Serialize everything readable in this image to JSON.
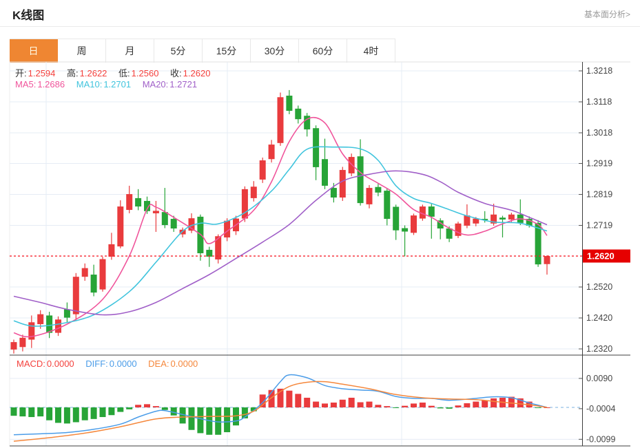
{
  "header": {
    "title": "K线图",
    "link": "基本面分析>"
  },
  "tabs": {
    "items": [
      "日",
      "周",
      "月",
      "5分",
      "15分",
      "30分",
      "60分",
      "4时"
    ],
    "active_index": 0
  },
  "info": {
    "open_label": "开:",
    "open": "1.2594",
    "high_label": "高:",
    "high": "1.2622",
    "low_label": "低:",
    "low": "1.2560",
    "close_label": "收:",
    "close": "1.2620",
    "ma5_label": "MA5:",
    "ma5": "1.2686",
    "ma10_label": "MA10:",
    "ma10": "1.2701",
    "ma20_label": "MA20:",
    "ma20": "1.2721"
  },
  "macd_info": {
    "macd_label": "MACD:",
    "macd": "0.0000",
    "diff_label": "DIFF:",
    "diff": "0.0000",
    "dea_label": "DEA:",
    "dea": "0.0000"
  },
  "colors": {
    "up": "#e93b3d",
    "down": "#27a437",
    "ma5": "#f0549b",
    "ma10": "#40c4dd",
    "ma20": "#a05fc8",
    "diff": "#4a9ce8",
    "dea": "#f5873b",
    "accent": "#ef8632",
    "marker_bg": "#e60000",
    "marker_text": "#ffffff",
    "grid": "#e6ecf5",
    "axis_text": "#444444",
    "axis_line": "#3c3c3c",
    "dotted": "#f5222d",
    "zero_dash": "#bcd8f0"
  },
  "chart_data": {
    "type": "candlestick",
    "title": "K线图 daily candlestick with MA5/MA10/MA20 and MACD",
    "price_ticks": [
      "1.3218",
      "1.3118",
      "1.3018",
      "1.2919",
      "1.2819",
      "1.2719",
      "1.2520",
      "1.2420",
      "1.2320"
    ],
    "current_price": {
      "label": "1.2620",
      "value": 1.262
    },
    "candles": [
      [
        1.2318,
        1.235,
        1.2305,
        1.2342
      ],
      [
        1.2326,
        1.2366,
        1.2312,
        1.2356
      ],
      [
        1.235,
        1.2428,
        1.2323,
        1.2406
      ],
      [
        1.24,
        1.2445,
        1.2385,
        1.2432
      ],
      [
        1.2428,
        1.244,
        1.2355,
        1.2372
      ],
      [
        1.2372,
        1.2425,
        1.2362,
        1.2415
      ],
      [
        1.2448,
        1.247,
        1.2405,
        1.2421
      ],
      [
        1.2432,
        1.2565,
        1.2413,
        1.2553
      ],
      [
        1.2553,
        1.2596,
        1.254,
        1.2581
      ],
      [
        1.256,
        1.2592,
        1.249,
        1.2502
      ],
      [
        1.2512,
        1.2618,
        1.2505,
        1.261
      ],
      [
        1.2618,
        1.2695,
        1.2608,
        1.2658
      ],
      [
        1.2651,
        1.28,
        1.2645,
        1.278
      ],
      [
        1.2769,
        1.2847,
        1.2758,
        1.282
      ],
      [
        1.2807,
        1.2836,
        1.2768,
        1.278
      ],
      [
        1.2798,
        1.2812,
        1.2756,
        1.2765
      ],
      [
        1.2758,
        1.2798,
        1.2698,
        1.2766
      ],
      [
        1.2762,
        1.284,
        1.271,
        1.272
      ],
      [
        1.274,
        1.275,
        1.2698,
        1.2709
      ],
      [
        1.269,
        1.2712,
        1.268,
        1.2705
      ],
      [
        1.2702,
        1.2758,
        1.2694,
        1.2742
      ],
      [
        1.2747,
        1.2754,
        1.2605,
        1.2629
      ],
      [
        1.264,
        1.265,
        1.2585,
        1.2618
      ],
      [
        1.2609,
        1.269,
        1.2596,
        1.2684
      ],
      [
        1.268,
        1.2742,
        1.2668,
        1.2734
      ],
      [
        1.27,
        1.275,
        1.2688,
        1.2741
      ],
      [
        1.2741,
        1.2845,
        1.273,
        1.2836
      ],
      [
        1.2807,
        1.2862,
        1.2796,
        1.2844
      ],
      [
        1.2867,
        1.2938,
        1.2856,
        1.2929
      ],
      [
        1.2933,
        1.2995,
        1.2922,
        1.298
      ],
      [
        1.2985,
        1.3148,
        1.2976,
        1.3133
      ],
      [
        1.3138,
        1.3156,
        1.3078,
        1.3089
      ],
      [
        1.3096,
        1.3106,
        1.3048,
        1.3062
      ],
      [
        1.3073,
        1.3082,
        1.3006,
        1.3029
      ],
      [
        1.3033,
        1.3042,
        1.2865,
        1.2907
      ],
      [
        1.2933,
        1.2999,
        1.2836,
        1.2847
      ],
      [
        1.284,
        1.2856,
        1.2793,
        1.2809
      ],
      [
        1.2809,
        1.2908,
        1.2798,
        1.2898
      ],
      [
        1.2887,
        1.2951,
        1.2878,
        1.294
      ],
      [
        1.2942,
        1.2997,
        1.2783,
        1.2791
      ],
      [
        1.2787,
        1.2849,
        1.2774,
        1.284
      ],
      [
        1.2843,
        1.2853,
        1.2813,
        1.2825
      ],
      [
        1.2831,
        1.2839,
        1.2719,
        1.274
      ],
      [
        1.2779,
        1.2786,
        1.2672,
        1.2703
      ],
      [
        1.271,
        1.2719,
        1.2619,
        1.2699
      ],
      [
        1.2695,
        1.2757,
        1.2688,
        1.2751
      ],
      [
        1.2741,
        1.2786,
        1.2734,
        1.278
      ],
      [
        1.278,
        1.2788,
        1.2676,
        1.2747
      ],
      [
        1.2735,
        1.2742,
        1.2674,
        1.2709
      ],
      [
        1.2709,
        1.2716,
        1.2665,
        1.2676
      ],
      [
        1.2685,
        1.2731,
        1.2678,
        1.2725
      ],
      [
        1.2718,
        1.2787,
        1.271,
        1.2751
      ],
      [
        1.2725,
        1.2746,
        1.2716,
        1.2741
      ],
      [
        1.274,
        1.2765,
        1.2728,
        1.2736
      ],
      [
        1.2725,
        1.2789,
        1.2718,
        1.2754
      ],
      [
        1.2744,
        1.275,
        1.268,
        1.2738
      ],
      [
        1.2738,
        1.276,
        1.273,
        1.2754
      ],
      [
        1.2754,
        1.2803,
        1.272,
        1.2727
      ],
      [
        1.274,
        1.2748,
        1.2712,
        1.2718
      ],
      [
        1.2727,
        1.2736,
        1.2585,
        1.2593
      ],
      [
        1.2594,
        1.2622,
        1.256,
        1.262
      ]
    ],
    "ma_lines": [
      {
        "name": "MA5",
        "color_key": "ma5",
        "points": [
          [
            0,
            1.2372
          ],
          [
            2,
            1.236
          ],
          [
            6,
            1.24
          ],
          [
            10,
            1.248
          ],
          [
            13,
            1.262
          ],
          [
            15,
            1.2772
          ],
          [
            16,
            1.2778
          ],
          [
            18,
            1.2745
          ],
          [
            21,
            1.269
          ],
          [
            22,
            1.266
          ],
          [
            24,
            1.27
          ],
          [
            27,
            1.2768
          ],
          [
            29,
            1.286
          ],
          [
            31,
            1.299
          ],
          [
            33,
            1.3062
          ],
          [
            35,
            1.305
          ],
          [
            37,
            1.295
          ],
          [
            39,
            1.289
          ],
          [
            41,
            1.2855
          ],
          [
            43,
            1.282
          ],
          [
            45,
            1.277
          ],
          [
            47,
            1.2745
          ],
          [
            49,
            1.271
          ],
          [
            51,
            1.2688
          ],
          [
            53,
            1.27
          ],
          [
            55,
            1.2724
          ],
          [
            57,
            1.274
          ],
          [
            59,
            1.2722
          ],
          [
            60,
            1.2686
          ]
        ]
      },
      {
        "name": "MA10",
        "color_key": "ma10",
        "points": [
          [
            0,
            1.2411
          ],
          [
            2,
            1.2394
          ],
          [
            5,
            1.24
          ],
          [
            9,
            1.243
          ],
          [
            13,
            1.2505
          ],
          [
            16,
            1.26
          ],
          [
            19,
            1.27
          ],
          [
            21,
            1.2726
          ],
          [
            23,
            1.2724
          ],
          [
            26,
            1.276
          ],
          [
            29,
            1.283
          ],
          [
            31,
            1.29
          ],
          [
            33,
            1.2965
          ],
          [
            36,
            1.2972
          ],
          [
            39,
            1.2966
          ],
          [
            41,
            1.2929
          ],
          [
            43,
            1.2847
          ],
          [
            45,
            1.2806
          ],
          [
            47,
            1.279
          ],
          [
            49,
            1.277
          ],
          [
            51,
            1.275
          ],
          [
            54,
            1.273
          ],
          [
            57,
            1.2726
          ],
          [
            60,
            1.2701
          ]
        ]
      },
      {
        "name": "MA20",
        "color_key": "ma20",
        "points": [
          [
            0,
            1.249
          ],
          [
            3,
            1.247
          ],
          [
            6,
            1.2448
          ],
          [
            10,
            1.243
          ],
          [
            13,
            1.244
          ],
          [
            16,
            1.247
          ],
          [
            19,
            1.2515
          ],
          [
            22,
            1.256
          ],
          [
            25,
            1.2612
          ],
          [
            28,
            1.2665
          ],
          [
            31,
            1.2722
          ],
          [
            34,
            1.28
          ],
          [
            37,
            1.2862
          ],
          [
            40,
            1.2884
          ],
          [
            43,
            1.2895
          ],
          [
            46,
            1.2884
          ],
          [
            48,
            1.286
          ],
          [
            50,
            1.2826
          ],
          [
            53,
            1.279
          ],
          [
            56,
            1.2768
          ],
          [
            58,
            1.2745
          ],
          [
            60,
            1.2721
          ]
        ]
      }
    ],
    "macd": {
      "ticks": [
        "0.0090",
        "-0.0004",
        "-0.0099"
      ],
      "bars": [
        -0.0026,
        -0.0028,
        -0.003,
        -0.0028,
        -0.004,
        -0.0048,
        -0.005,
        -0.0046,
        -0.004,
        -0.0036,
        -0.003,
        -0.0024,
        -0.0014,
        -0.0006,
        0.0008,
        0.001,
        0.0004,
        -0.0008,
        -0.0025,
        -0.005,
        -0.007,
        -0.008,
        -0.0085,
        -0.0085,
        -0.0077,
        -0.0056,
        -0.0034,
        -0.0012,
        0.004,
        0.0054,
        0.0058,
        0.0052,
        0.0042,
        0.003,
        0.0018,
        0.0012,
        0.0015,
        0.0024,
        0.003,
        0.0016,
        0.0018,
        0.0008,
        0.0004,
        -0.0002,
        0.0005,
        0.0012,
        0.0015,
        0.0005,
        -0.0003,
        -0.0004,
        0.0006,
        0.0013,
        0.0018,
        0.0022,
        0.0028,
        0.003,
        0.0033,
        0.0028,
        0.0018,
        -0.0002,
        0.0
      ],
      "lines": [
        {
          "name": "DIFF",
          "color_key": "diff",
          "points": [
            [
              0,
              -0.0085
            ],
            [
              3,
              -0.0082
            ],
            [
              6,
              -0.0078
            ],
            [
              9,
              -0.0068
            ],
            [
              12,
              -0.0052
            ],
            [
              14,
              -0.003
            ],
            [
              16,
              -0.0012
            ],
            [
              17,
              -0.001
            ],
            [
              19,
              -0.0022
            ],
            [
              21,
              -0.0035
            ],
            [
              23,
              -0.0045
            ],
            [
              25,
              -0.0042
            ],
            [
              26,
              -0.003
            ],
            [
              28,
              0.0015
            ],
            [
              30,
              0.008
            ],
            [
              31,
              0.0101
            ],
            [
              33,
              0.0092
            ],
            [
              35,
              0.0068
            ],
            [
              37,
              0.0058
            ],
            [
              39,
              0.0054
            ],
            [
              41,
              0.005
            ],
            [
              43,
              0.0034
            ],
            [
              45,
              0.0028
            ],
            [
              47,
              0.0028
            ],
            [
              49,
              0.0022
            ],
            [
              52,
              0.0028
            ],
            [
              54,
              0.0033
            ],
            [
              56,
              0.003
            ],
            [
              58,
              0.0014
            ],
            [
              60,
              0.0
            ]
          ]
        },
        {
          "name": "DEA",
          "color_key": "dea",
          "points": [
            [
              0,
              -0.0105
            ],
            [
              4,
              -0.0094
            ],
            [
              8,
              -0.008
            ],
            [
              12,
              -0.006
            ],
            [
              16,
              -0.0036
            ],
            [
              19,
              -0.003
            ],
            [
              22,
              -0.0028
            ],
            [
              25,
              -0.0026
            ],
            [
              27,
              -0.0012
            ],
            [
              29,
              0.003
            ],
            [
              31,
              0.0065
            ],
            [
              33,
              0.0078
            ],
            [
              35,
              0.008
            ],
            [
              37,
              0.0072
            ],
            [
              40,
              0.0058
            ],
            [
              43,
              0.004
            ],
            [
              46,
              0.003
            ],
            [
              49,
              0.0026
            ],
            [
              52,
              0.0024
            ],
            [
              55,
              0.0016
            ],
            [
              58,
              0.0008
            ],
            [
              60,
              0.0
            ]
          ]
        }
      ]
    }
  }
}
